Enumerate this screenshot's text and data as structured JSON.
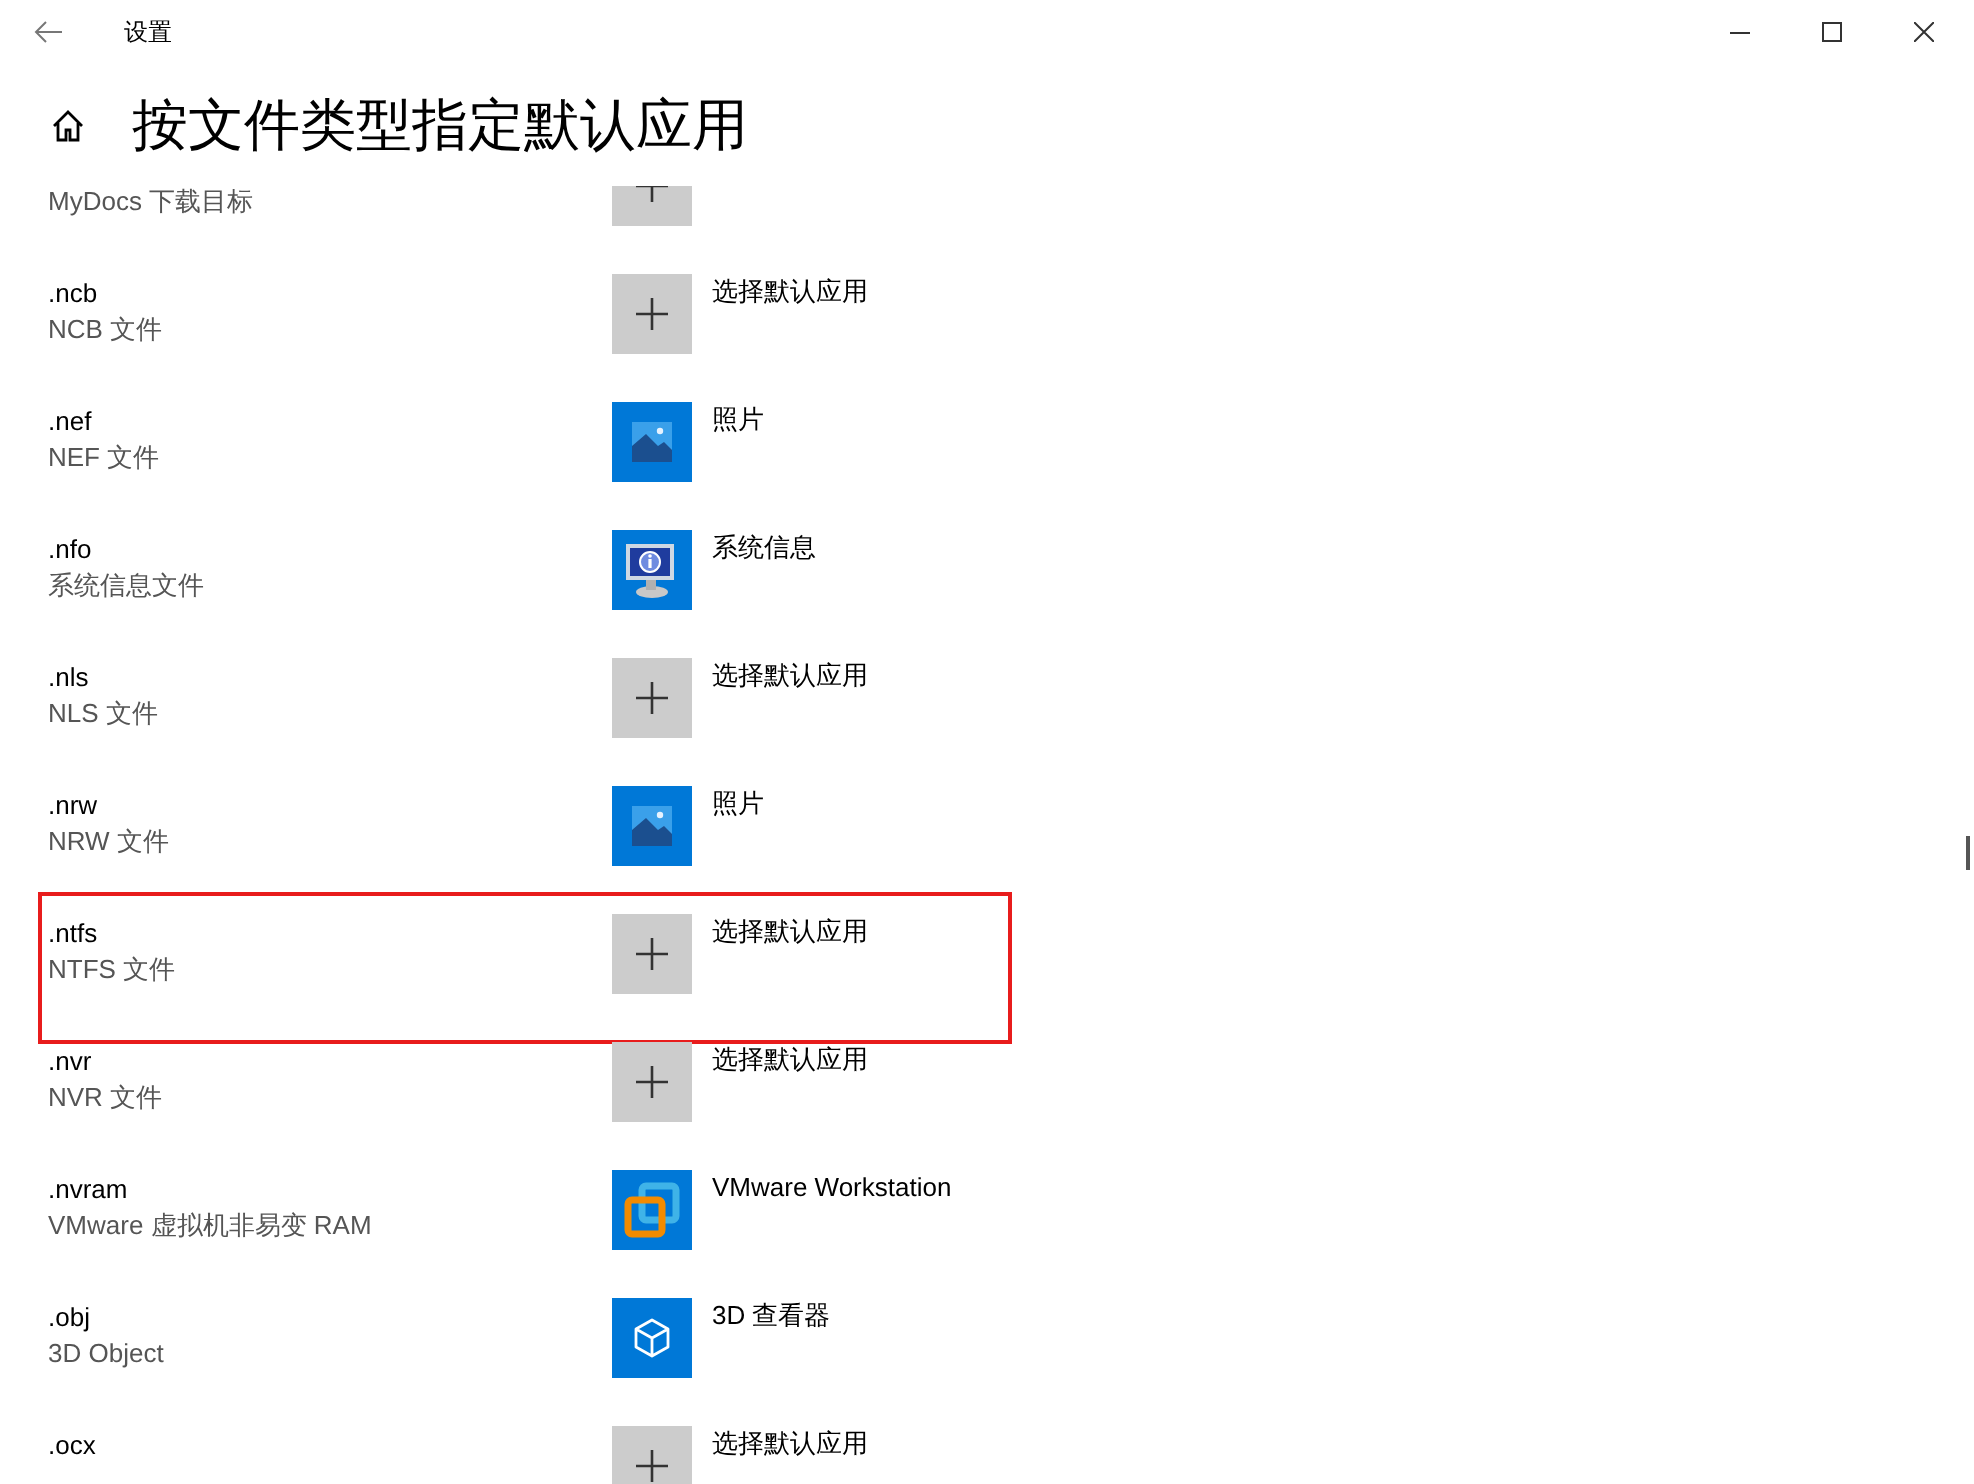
{
  "window": {
    "title": "设置"
  },
  "page": {
    "title": "按文件类型指定默认应用"
  },
  "rows": [
    {
      "description": "MyDocs 下载目标",
      "kind": "add",
      "highlighted": false
    },
    {
      "extension": ".ncb",
      "description": "NCB 文件",
      "kind": "add",
      "app": "选择默认应用",
      "highlighted": false
    },
    {
      "extension": ".nef",
      "description": "NEF 文件",
      "kind": "photos",
      "app": "照片",
      "highlighted": false
    },
    {
      "extension": ".nfo",
      "description": "系统信息文件",
      "kind": "sysinfo",
      "app": "系统信息",
      "highlighted": false
    },
    {
      "extension": ".nls",
      "description": "NLS 文件",
      "kind": "add",
      "app": "选择默认应用",
      "highlighted": false
    },
    {
      "extension": ".nrw",
      "description": "NRW 文件",
      "kind": "photos",
      "app": "照片",
      "highlighted": false
    },
    {
      "extension": ".ntfs",
      "description": "NTFS 文件",
      "kind": "add",
      "app": "选择默认应用",
      "highlighted": true
    },
    {
      "extension": ".nvr",
      "description": "NVR 文件",
      "kind": "add",
      "app": "选择默认应用",
      "highlighted": false
    },
    {
      "extension": ".nvram",
      "description": "VMware 虚拟机非易变 RAM",
      "kind": "vmware",
      "app": "VMware Workstation",
      "highlighted": false
    },
    {
      "extension": ".obj",
      "description": "3D Object",
      "kind": "viewer3d",
      "app": "3D 查看器",
      "highlighted": false
    },
    {
      "extension": ".ocx",
      "kind": "add",
      "app": "选择默认应用",
      "highlighted": false
    }
  ]
}
